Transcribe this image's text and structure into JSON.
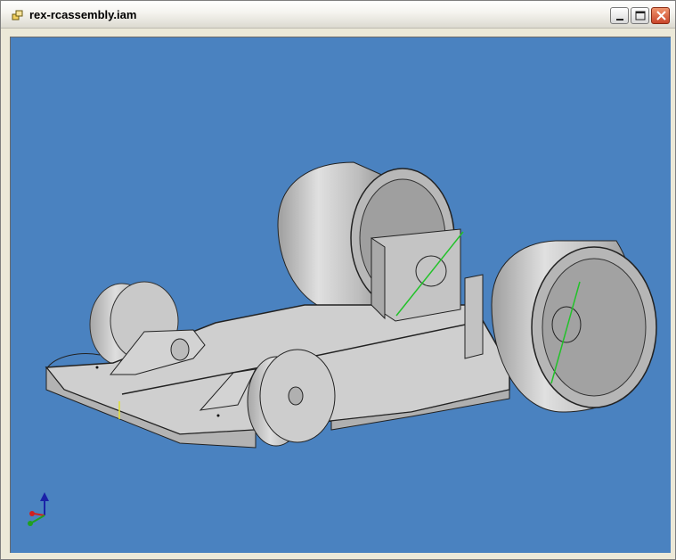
{
  "window": {
    "title": "rex-rcassembly.iam",
    "icons": {
      "app": "assembly-icon",
      "minimize": "minimize-icon",
      "maximize": "maximize-icon",
      "close": "close-icon"
    },
    "colors": {
      "viewport_background": "#4a82c0",
      "part_gray": "#c8c8c8",
      "constraint_green": "#22c22a",
      "close_button": "#d2552f"
    }
  },
  "viewport": {
    "content": "3d-assembly-model",
    "triad_icon": "xyz-axis-triad-icon"
  }
}
